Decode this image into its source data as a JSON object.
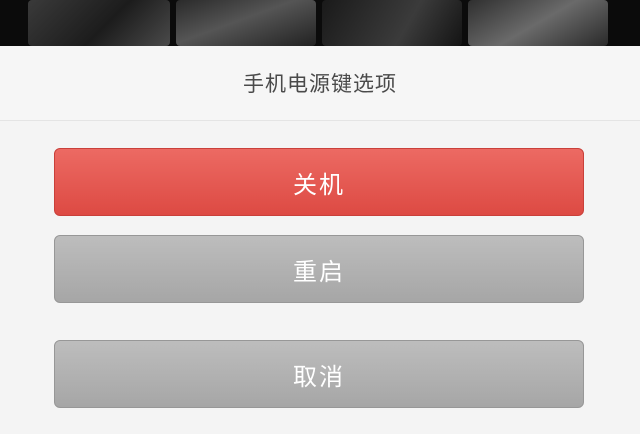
{
  "dialog": {
    "title": "手机电源键选项",
    "buttons": {
      "shutdown": "关机",
      "restart": "重启",
      "cancel": "取消"
    }
  },
  "colors": {
    "danger": "#e55a53",
    "neutral": "#b1b1b1",
    "sheet_bg": "#f4f4f4"
  }
}
